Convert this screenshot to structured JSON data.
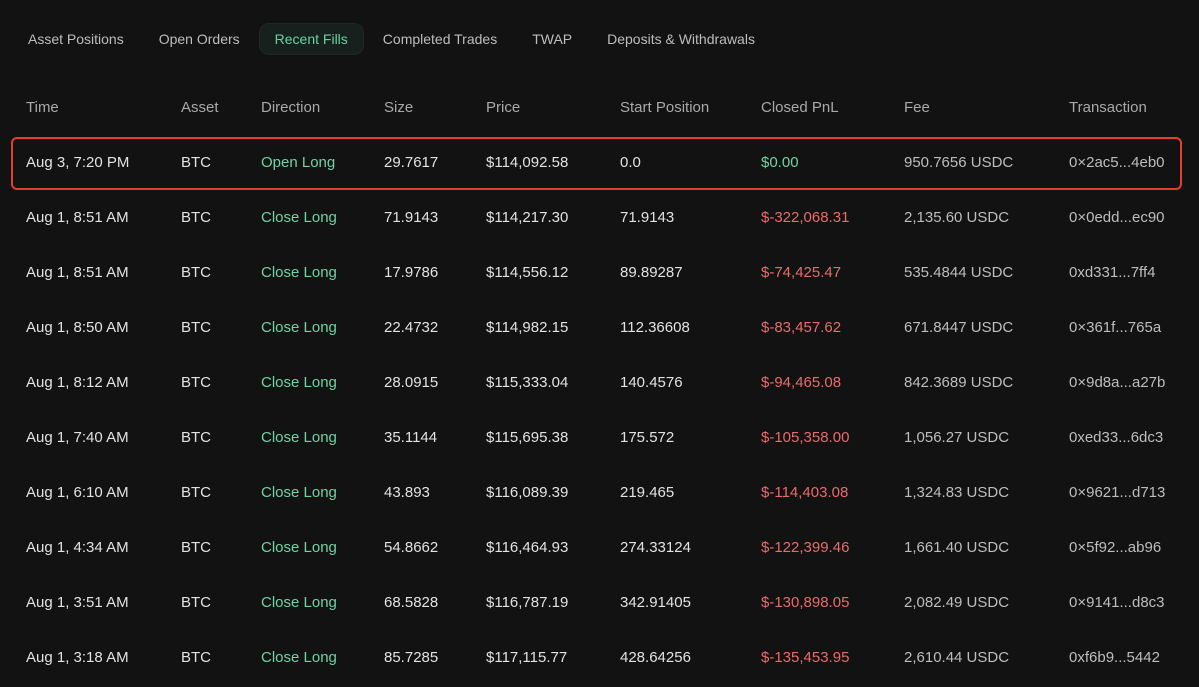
{
  "tabs": [
    {
      "label": "Asset Positions",
      "active": false
    },
    {
      "label": "Open Orders",
      "active": false
    },
    {
      "label": "Recent Fills",
      "active": true
    },
    {
      "label": "Completed Trades",
      "active": false
    },
    {
      "label": "TWAP",
      "active": false
    },
    {
      "label": "Deposits & Withdrawals",
      "active": false
    }
  ],
  "columns": {
    "time": "Time",
    "asset": "Asset",
    "direction": "Direction",
    "size": "Size",
    "price": "Price",
    "start_position": "Start Position",
    "closed_pnl": "Closed PnL",
    "fee": "Fee",
    "transaction": "Transaction"
  },
  "rows": [
    {
      "time": "Aug 3, 7:20 PM",
      "asset": "BTC",
      "direction": "Open Long",
      "size": "29.7617",
      "price": "$114,092.58",
      "start_position": "0.0",
      "closed_pnl": "$0.00",
      "pnl_sign": "pos",
      "fee": "950.7656 USDC",
      "transaction": "0×2ac5...4eb0"
    },
    {
      "time": "Aug 1, 8:51 AM",
      "asset": "BTC",
      "direction": "Close Long",
      "size": "71.9143",
      "price": "$114,217.30",
      "start_position": "71.9143",
      "closed_pnl": "$-322,068.31",
      "pnl_sign": "neg",
      "fee": "2,135.60 USDC",
      "transaction": "0×0edd...ec90"
    },
    {
      "time": "Aug 1, 8:51 AM",
      "asset": "BTC",
      "direction": "Close Long",
      "size": "17.9786",
      "price": "$114,556.12",
      "start_position": "89.89287",
      "closed_pnl": "$-74,425.47",
      "pnl_sign": "neg",
      "fee": "535.4844 USDC",
      "transaction": "0xd331...7ff4"
    },
    {
      "time": "Aug 1, 8:50 AM",
      "asset": "BTC",
      "direction": "Close Long",
      "size": "22.4732",
      "price": "$114,982.15",
      "start_position": "112.36608",
      "closed_pnl": "$-83,457.62",
      "pnl_sign": "neg",
      "fee": "671.8447 USDC",
      "transaction": "0×361f...765a"
    },
    {
      "time": "Aug 1, 8:12 AM",
      "asset": "BTC",
      "direction": "Close Long",
      "size": "28.0915",
      "price": "$115,333.04",
      "start_position": "140.4576",
      "closed_pnl": "$-94,465.08",
      "pnl_sign": "neg",
      "fee": "842.3689 USDC",
      "transaction": "0×9d8a...a27b"
    },
    {
      "time": "Aug 1, 7:40 AM",
      "asset": "BTC",
      "direction": "Close Long",
      "size": "35.1144",
      "price": "$115,695.38",
      "start_position": "175.572",
      "closed_pnl": "$-105,358.00",
      "pnl_sign": "neg",
      "fee": "1,056.27 USDC",
      "transaction": "0xed33...6dc3"
    },
    {
      "time": "Aug 1, 6:10 AM",
      "asset": "BTC",
      "direction": "Close Long",
      "size": "43.893",
      "price": "$116,089.39",
      "start_position": "219.465",
      "closed_pnl": "$-114,403.08",
      "pnl_sign": "neg",
      "fee": "1,324.83 USDC",
      "transaction": "0×9621...d713"
    },
    {
      "time": "Aug 1, 4:34 AM",
      "asset": "BTC",
      "direction": "Close Long",
      "size": "54.8662",
      "price": "$116,464.93",
      "start_position": "274.33124",
      "closed_pnl": "$-122,399.46",
      "pnl_sign": "neg",
      "fee": "1,661.40 USDC",
      "transaction": "0×5f92...ab96"
    },
    {
      "time": "Aug 1, 3:51 AM",
      "asset": "BTC",
      "direction": "Close Long",
      "size": "68.5828",
      "price": "$116,787.19",
      "start_position": "342.91405",
      "closed_pnl": "$-130,898.05",
      "pnl_sign": "neg",
      "fee": "2,082.49 USDC",
      "transaction": "0×9141...d8c3"
    },
    {
      "time": "Aug 1, 3:18 AM",
      "asset": "BTC",
      "direction": "Close Long",
      "size": "85.7285",
      "price": "$117,115.77",
      "start_position": "428.64256",
      "closed_pnl": "$-135,453.95",
      "pnl_sign": "neg",
      "fee": "2,610.44 USDC",
      "transaction": "0xf6b9...5442"
    }
  ],
  "colors": {
    "background": "#121212",
    "positive": "#6fd3a4",
    "negative": "#ea6b6b",
    "highlight": "#e3402a",
    "tab_active": "#62d3a0"
  }
}
